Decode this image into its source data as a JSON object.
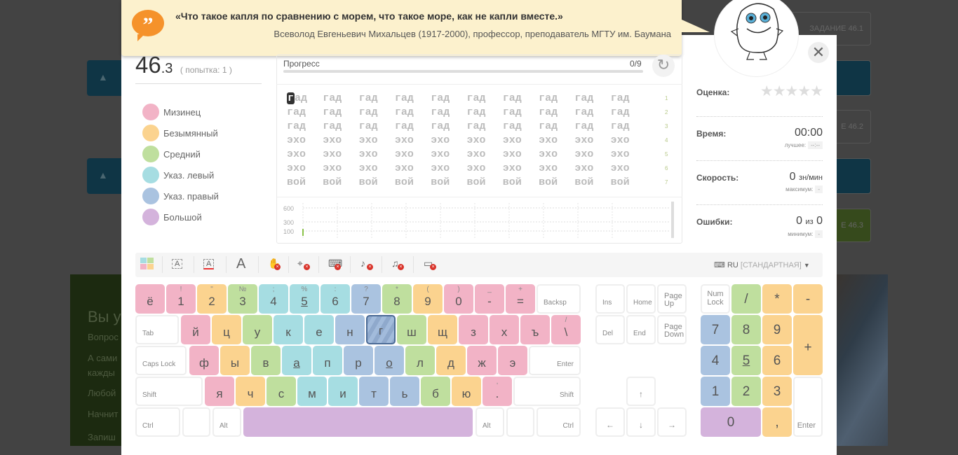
{
  "background": {
    "right_tiles": [
      {
        "label": "ЗАДАНИЕ 46.1",
        "color": "#434343"
      },
      {
        "label": "",
        "color": "#0f3545"
      },
      {
        "label": "Е 46.2",
        "color": "#434343"
      },
      {
        "label": "",
        "color": "#0f3545"
      },
      {
        "label": "Е 46.3",
        "color": "#364a1c"
      }
    ],
    "left_tiles_icon": "graduation-cap-icon",
    "left_block_lines": [
      "Вы у",
      "Вопрос",
      "А сами",
      "кажды",
      "Любой",
      "Начнит",
      "Запиш"
    ]
  },
  "quote": {
    "icon": "quote-icon",
    "text": "«Что такое капля по сравнению с морем, что такое море, как не капли вместе.»",
    "author": "Всеволод Евгеньевич Михальцев (1917-2000), профессор, преподаватель МГТУ им. Баумана"
  },
  "exercise": {
    "number": "46",
    "sub": ".3",
    "attempt": "( попытка: 1 )"
  },
  "legend": [
    {
      "label": "Мизинец",
      "color": "#f2b3c6"
    },
    {
      "label": "Безымянный",
      "color": "#fbd38f"
    },
    {
      "label": "Средний",
      "color": "#bfdf9e"
    },
    {
      "label": "Указ. левый",
      "color": "#a6dde2"
    },
    {
      "label": "Указ. правый",
      "color": "#aac3e0"
    },
    {
      "label": "Большой",
      "color": "#d4b3dc"
    }
  ],
  "progress": {
    "label": "Прогресс",
    "value": "0/9",
    "fraction": 0
  },
  "text_lines": [
    {
      "words": [
        "гад",
        "гад",
        "гад",
        "гад",
        "гад",
        "гад",
        "гад",
        "гад",
        "гад",
        "гад"
      ],
      "num": "1"
    },
    {
      "words": [
        "гад",
        "гад",
        "гад",
        "гад",
        "гад",
        "гад",
        "гад",
        "гад",
        "гад",
        "гад"
      ],
      "num": "2"
    },
    {
      "words": [
        "гад",
        "гад",
        "гад",
        "гад",
        "гад",
        "гад",
        "гад",
        "гад",
        "гад",
        "гад"
      ],
      "num": "3"
    },
    {
      "words": [
        "эхо",
        "эхо",
        "эхо",
        "эхо",
        "эхо",
        "эхо",
        "эхо",
        "эхо",
        "эхо",
        "эхо"
      ],
      "num": "4"
    },
    {
      "words": [
        "эхо",
        "эхо",
        "эхо",
        "эхо",
        "эхо",
        "эхо",
        "эхо",
        "эхо",
        "эхо",
        "эхо"
      ],
      "num": "5"
    },
    {
      "words": [
        "эхо",
        "эхо",
        "эхо",
        "эхо",
        "эхо",
        "эхо",
        "эхо",
        "эхо",
        "эхо",
        "эхо"
      ],
      "num": "6"
    },
    {
      "words": [
        "вой",
        "вой",
        "вой",
        "вой",
        "вой",
        "вой",
        "вой",
        "вой",
        "вой",
        "вой"
      ],
      "num": "7"
    }
  ],
  "speed_chart": {
    "y_ticks": [
      "600",
      "300",
      "100"
    ]
  },
  "stats": {
    "rating_label": "Оценка:",
    "stars": 0,
    "stars_max": 5,
    "time_label": "Время:",
    "time": "00:00",
    "best_label": "лучшее:",
    "best": "--:--",
    "speed_label": "Скорость:",
    "speed": "0",
    "speed_unit": "зн/мин",
    "max_label": "максимум:",
    "max": "-",
    "errors_label": "Ошибки:",
    "errors": "0",
    "errors_of": "из",
    "errors_total": "0",
    "min_label": "минимум:",
    "min": "-"
  },
  "toolbar": {
    "icons": [
      "color-keys-icon",
      "font-box-icon",
      "font-underline-icon",
      "font-size-icon",
      "hand-off-icon",
      "cursor-eye-icon",
      "keyboard-sound-off-icon",
      "ear-sound-off-icon",
      "metronome-off-icon",
      "window-off-icon"
    ],
    "font_label": "A",
    "layout_lang": "RU",
    "layout_name": "[СТАНДАРТНАЯ]"
  },
  "colors": {
    "p": "#f2b3c6",
    "o": "#fbd38f",
    "g": "#bfdf9e",
    "t": "#a6dde2",
    "b": "#aac3e0",
    "u": "#d4b3dc",
    "w": "#ffffff"
  },
  "active_key": "г",
  "keyboard": [
    [
      [
        "ё",
        "",
        "p"
      ],
      [
        "1",
        "!",
        "p"
      ],
      [
        "2",
        "\"",
        "o"
      ],
      [
        "3",
        "№",
        "g"
      ],
      [
        "4",
        ";",
        "t"
      ],
      [
        "5",
        "%",
        "t"
      ],
      [
        "6",
        ":",
        "t"
      ],
      [
        "7",
        "?",
        "b"
      ],
      [
        "8",
        "*",
        "g"
      ],
      [
        "9",
        "(",
        "o"
      ],
      [
        "0",
        ")",
        "p"
      ],
      [
        "-",
        "_",
        "p"
      ],
      [
        "=",
        "+",
        "p"
      ],
      [
        "Backsp",
        "",
        "w"
      ]
    ],
    [
      [
        "Tab",
        "",
        "w"
      ],
      [
        "й",
        "",
        "p"
      ],
      [
        "ц",
        "",
        "o"
      ],
      [
        "у",
        "",
        "g"
      ],
      [
        "к",
        "",
        "t"
      ],
      [
        "е",
        "",
        "t"
      ],
      [
        "н",
        "",
        "b"
      ],
      [
        "г",
        "",
        "b"
      ],
      [
        "ш",
        "",
        "g"
      ],
      [
        "щ",
        "",
        "o"
      ],
      [
        "з",
        "",
        "p"
      ],
      [
        "х",
        "",
        "p"
      ],
      [
        "ъ",
        "",
        "p"
      ],
      [
        "\\",
        "/",
        "p"
      ]
    ],
    [
      [
        "Caps Lock",
        "",
        "w"
      ],
      [
        "ф",
        "",
        "p"
      ],
      [
        "ы",
        "",
        "o"
      ],
      [
        "в",
        "",
        "g"
      ],
      [
        "а",
        "",
        "t"
      ],
      [
        "п",
        "",
        "t"
      ],
      [
        "р",
        "",
        "b"
      ],
      [
        "о",
        "",
        "b"
      ],
      [
        "л",
        "",
        "g"
      ],
      [
        "д",
        "",
        "o"
      ],
      [
        "ж",
        "",
        "p"
      ],
      [
        "э",
        "",
        "p"
      ],
      [
        "Enter",
        "",
        "w"
      ]
    ],
    [
      [
        "Shift",
        "",
        "w"
      ],
      [
        "я",
        "",
        "p"
      ],
      [
        "ч",
        "",
        "o"
      ],
      [
        "с",
        "",
        "g"
      ],
      [
        "м",
        "",
        "t"
      ],
      [
        "и",
        "",
        "t"
      ],
      [
        "т",
        "",
        "b"
      ],
      [
        "ь",
        "",
        "b"
      ],
      [
        "б",
        "",
        "g"
      ],
      [
        "ю",
        "",
        "o"
      ],
      [
        ".",
        ",",
        "p"
      ],
      [
        "Shift",
        "",
        "w"
      ]
    ],
    [
      [
        "Ctrl",
        "",
        "w"
      ],
      [
        "",
        "",
        "w"
      ],
      [
        "Alt",
        "",
        "w"
      ],
      [
        "",
        "",
        "u"
      ],
      [
        "Alt",
        "",
        "w"
      ],
      [
        "",
        "",
        "w"
      ],
      [
        "Ctrl",
        "",
        "w"
      ]
    ]
  ],
  "nav_keys": [
    "Ins",
    "Home",
    "Page Up",
    "Del",
    "End",
    "Page Down",
    "↑",
    "←",
    "↓",
    "→"
  ],
  "numpad": [
    [
      "Num Lock",
      "w"
    ],
    [
      "/",
      "g"
    ],
    [
      "*",
      "o"
    ],
    [
      "-",
      "o"
    ],
    [
      "7",
      "b"
    ],
    [
      "8",
      "g"
    ],
    [
      "9",
      "o"
    ],
    [
      "+",
      "o"
    ],
    [
      "4",
      "b"
    ],
    [
      "5",
      "g"
    ],
    [
      "6",
      "o"
    ],
    [
      "1",
      "b"
    ],
    [
      "2",
      "g"
    ],
    [
      "3",
      "o"
    ],
    [
      "Enter",
      "w"
    ],
    [
      "0",
      "u"
    ],
    [
      ",",
      "o"
    ]
  ]
}
